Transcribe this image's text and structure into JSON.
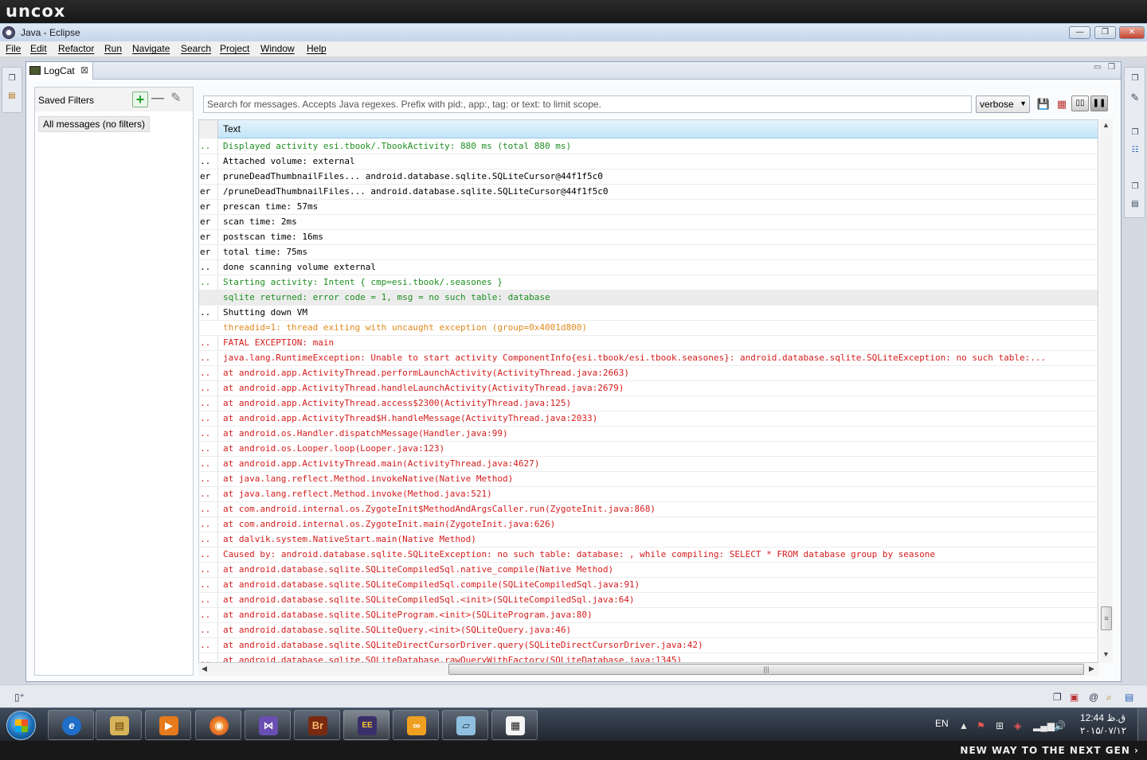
{
  "branding": {
    "logo": "uncox",
    "slogan": "NEW WAY TO THE NEXT GEN ›"
  },
  "window": {
    "title": "Java - Eclipse",
    "minimize": "—",
    "restore": "❐",
    "close": "✕"
  },
  "menu": [
    "File",
    "Edit",
    "Refactor",
    "Run",
    "Navigate",
    "Search",
    "Project",
    "Window",
    "Help"
  ],
  "view": {
    "tab_label": "LogCat",
    "tab_close": "⊠"
  },
  "filters": {
    "title": "Saved Filters",
    "add": "+",
    "remove": "—",
    "edit": "✎",
    "items": [
      "All messages (no filters)"
    ]
  },
  "search": {
    "placeholder": "Search for messages. Accepts Java regexes. Prefix with pid:, app:, tag: or text: to limit scope."
  },
  "log_level": {
    "selected": "verbose"
  },
  "table": {
    "column_text": "Text",
    "rows": [
      {
        "lvl": "..",
        "text": "Displayed activity esi.tbook/.TbookActivity: 880 ms (total 880 ms)",
        "color": "green"
      },
      {
        "lvl": "..",
        "text": "Attached volume: external",
        "color": "black"
      },
      {
        "lvl": "er",
        "text": "pruneDeadThumbnailFiles... android.database.sqlite.SQLiteCursor@44f1f5c0",
        "color": "black"
      },
      {
        "lvl": "er",
        "text": "/pruneDeadThumbnailFiles... android.database.sqlite.SQLiteCursor@44f1f5c0",
        "color": "black"
      },
      {
        "lvl": "er",
        "text": " prescan time: 57ms",
        "color": "black"
      },
      {
        "lvl": "er",
        "text": "    scan time: 2ms",
        "color": "black"
      },
      {
        "lvl": "er",
        "text": "postscan time: 16ms",
        "color": "black"
      },
      {
        "lvl": "er",
        "text": "   total time: 75ms",
        "color": "black"
      },
      {
        "lvl": "..",
        "text": "done scanning volume external",
        "color": "black"
      },
      {
        "lvl": "..",
        "text": "Starting activity: Intent { cmp=esi.tbook/.seasones }",
        "color": "green"
      },
      {
        "lvl": "",
        "text": "sqlite returned: error code = 1, msg = no such table: database",
        "color": "green"
      },
      {
        "lvl": "..",
        "text": "Shutting down VM",
        "color": "black"
      },
      {
        "lvl": "",
        "text": "threadid=1: thread exiting with uncaught exception (group=0x4001d800)",
        "color": "orange"
      },
      {
        "lvl": "..",
        "text": "FATAL EXCEPTION: main",
        "color": "red"
      },
      {
        "lvl": "..",
        "text": "java.lang.RuntimeException: Unable to start activity ComponentInfo{esi.tbook/esi.tbook.seasones}: android.database.sqlite.SQLiteException: no such table:...",
        "color": "red"
      },
      {
        "lvl": "..",
        "text": "at android.app.ActivityThread.performLaunchActivity(ActivityThread.java:2663)",
        "color": "red"
      },
      {
        "lvl": "..",
        "text": "at android.app.ActivityThread.handleLaunchActivity(ActivityThread.java:2679)",
        "color": "red"
      },
      {
        "lvl": "..",
        "text": "at android.app.ActivityThread.access$2300(ActivityThread.java:125)",
        "color": "red"
      },
      {
        "lvl": "..",
        "text": "at android.app.ActivityThread$H.handleMessage(ActivityThread.java:2033)",
        "color": "red"
      },
      {
        "lvl": "..",
        "text": "at android.os.Handler.dispatchMessage(Handler.java:99)",
        "color": "red"
      },
      {
        "lvl": "..",
        "text": "at android.os.Looper.loop(Looper.java:123)",
        "color": "red"
      },
      {
        "lvl": "..",
        "text": "at android.app.ActivityThread.main(ActivityThread.java:4627)",
        "color": "red"
      },
      {
        "lvl": "..",
        "text": "at java.lang.reflect.Method.invokeNative(Native Method)",
        "color": "red"
      },
      {
        "lvl": "..",
        "text": "at java.lang.reflect.Method.invoke(Method.java:521)",
        "color": "red"
      },
      {
        "lvl": "..",
        "text": "at com.android.internal.os.ZygoteInit$MethodAndArgsCaller.run(ZygoteInit.java:868)",
        "color": "red"
      },
      {
        "lvl": "..",
        "text": "at com.android.internal.os.ZygoteInit.main(ZygoteInit.java:626)",
        "color": "red"
      },
      {
        "lvl": "..",
        "text": "at dalvik.system.NativeStart.main(Native Method)",
        "color": "red"
      },
      {
        "lvl": "..",
        "text": "Caused by: android.database.sqlite.SQLiteException: no such table: database: , while compiling: SELECT * FROM database group by seasone",
        "color": "red"
      },
      {
        "lvl": "..",
        "text": "at android.database.sqlite.SQLiteCompiledSql.native_compile(Native Method)",
        "color": "red"
      },
      {
        "lvl": "..",
        "text": "at android.database.sqlite.SQLiteCompiledSql.compile(SQLiteCompiledSql.java:91)",
        "color": "red"
      },
      {
        "lvl": "..",
        "text": "at android.database.sqlite.SQLiteCompiledSql.<init>(SQLiteCompiledSql.java:64)",
        "color": "red"
      },
      {
        "lvl": "..",
        "text": "at android.database.sqlite.SQLiteProgram.<init>(SQLiteProgram.java:80)",
        "color": "red"
      },
      {
        "lvl": "..",
        "text": "at android.database.sqlite.SQLiteQuery.<init>(SQLiteQuery.java:46)",
        "color": "red"
      },
      {
        "lvl": "..",
        "text": "at android.database.sqlite.SQLiteDirectCursorDriver.query(SQLiteDirectCursorDriver.java:42)",
        "color": "red"
      },
      {
        "lvl": "..",
        "text": "at android.database.sqlite.SQLiteDatabase.rawQueryWithFactory(SQLiteDatabase.java:1345)",
        "color": "red"
      }
    ],
    "selected_index": 10
  },
  "colors": {
    "green": "#1e8f22",
    "black": "#000000",
    "orange": "#e08a1e",
    "red": "#d41c1c",
    "header": "#c3e5f8"
  },
  "taskbar": {
    "apps": [
      {
        "name": "internet-explorer",
        "glyph": "e"
      },
      {
        "name": "file-explorer",
        "glyph": "▤"
      },
      {
        "name": "media-player",
        "glyph": "▶"
      },
      {
        "name": "firefox",
        "glyph": "◉"
      },
      {
        "name": "visual-studio",
        "glyph": "⋈"
      },
      {
        "name": "adobe-bridge",
        "glyph": "Br"
      },
      {
        "name": "java-ee-ide",
        "glyph": "EE"
      },
      {
        "name": "app-ring",
        "glyph": "∞"
      },
      {
        "name": "notepad",
        "glyph": "▱"
      },
      {
        "name": "document",
        "glyph": "▦"
      }
    ],
    "lang": "EN",
    "clock_time": "ق.ظ 12:44",
    "clock_date": "۲۰۱۵/۰۷/۱۲"
  }
}
